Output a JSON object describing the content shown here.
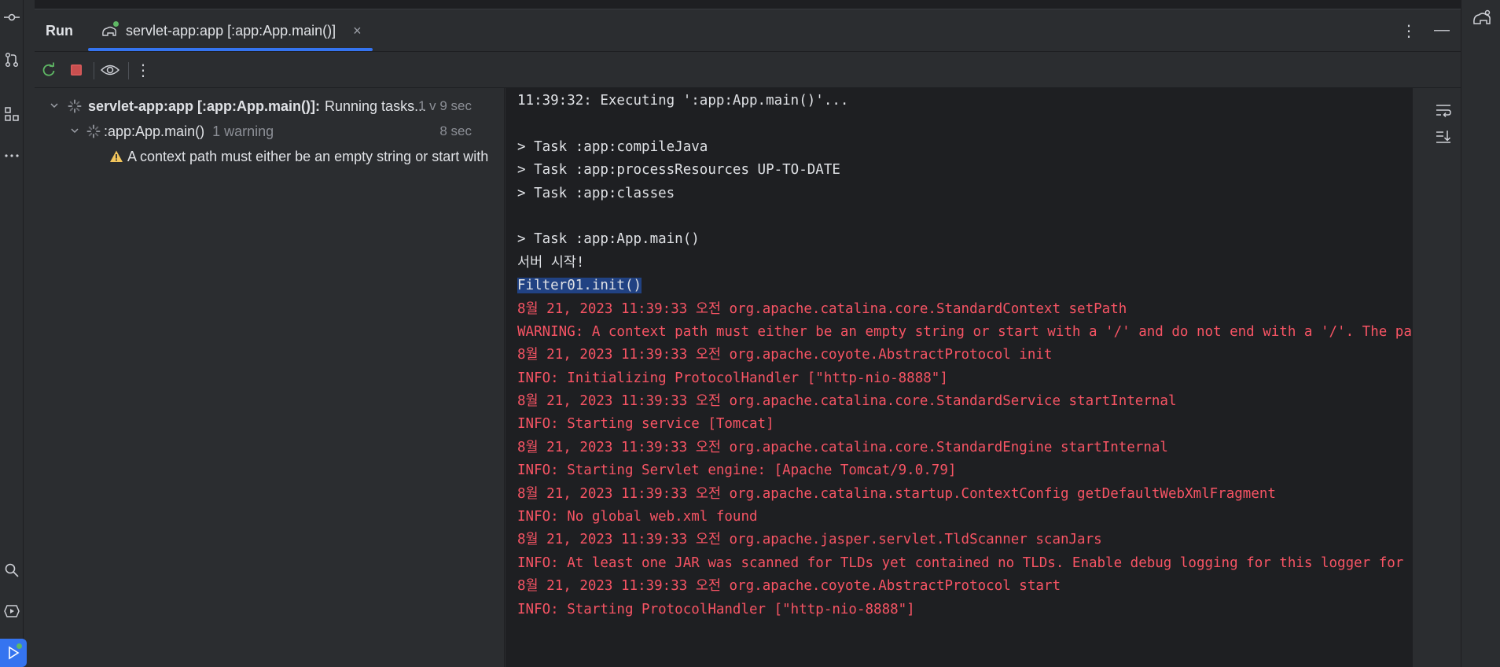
{
  "header": {
    "title": "Run",
    "tab_label": "servlet-app:app [:app:App.main()]",
    "close_glyph": "×",
    "more_glyph": "⋮",
    "minimize_glyph": "—"
  },
  "toolbar": {
    "items": [
      "rerun-icon",
      "stop-icon",
      "eye-icon",
      "more-vertical-icon"
    ],
    "more_glyph": "⋮"
  },
  "tree": {
    "root": {
      "name": "servlet-app:app [:app:App.main()]:",
      "status": "Running tasks...",
      "time": "1 v 9 sec"
    },
    "child": {
      "name": ":app:App.main()",
      "note": "1 warning",
      "time": "8 sec"
    },
    "warning": {
      "text": "A context path must either be an empty string or start with"
    }
  },
  "console": {
    "lines": [
      {
        "text": "11:39:32: Executing ':app:App.main()'...",
        "style": "normal"
      },
      {
        "text": "",
        "style": "normal"
      },
      {
        "text": "> Task :app:compileJava",
        "style": "normal"
      },
      {
        "text": "> Task :app:processResources UP-TO-DATE",
        "style": "normal"
      },
      {
        "text": "> Task :app:classes",
        "style": "normal"
      },
      {
        "text": "",
        "style": "normal"
      },
      {
        "text": "> Task :app:App.main()",
        "style": "normal"
      },
      {
        "text": "서버 시작!",
        "style": "normal"
      },
      {
        "text": "Filter01.init()",
        "style": "selected"
      },
      {
        "text": "8월 21, 2023 11:39:33 오전 org.apache.catalina.core.StandardContext setPath",
        "style": "err"
      },
      {
        "text": "WARNING: A context path must either be an empty string or start with a '/' and do not end with a '/'. The path [/]",
        "style": "err"
      },
      {
        "text": "8월 21, 2023 11:39:33 오전 org.apache.coyote.AbstractProtocol init",
        "style": "err"
      },
      {
        "text": "INFO: Initializing ProtocolHandler [\"http-nio-8888\"]",
        "style": "err"
      },
      {
        "text": "8월 21, 2023 11:39:33 오전 org.apache.catalina.core.StandardService startInternal",
        "style": "err"
      },
      {
        "text": "INFO: Starting service [Tomcat]",
        "style": "err"
      },
      {
        "text": "8월 21, 2023 11:39:33 오전 org.apache.catalina.core.StandardEngine startInternal",
        "style": "err"
      },
      {
        "text": "INFO: Starting Servlet engine: [Apache Tomcat/9.0.79]",
        "style": "err"
      },
      {
        "text": "8월 21, 2023 11:39:33 오전 org.apache.catalina.startup.ContextConfig getDefaultWebXmlFragment",
        "style": "err"
      },
      {
        "text": "INFO: No global web.xml found",
        "style": "err"
      },
      {
        "text": "8월 21, 2023 11:39:33 오전 org.apache.jasper.servlet.TldScanner scanJars",
        "style": "err"
      },
      {
        "text": "INFO: At least one JAR was scanned for TLDs yet contained no TLDs. Enable debug logging for this logger for a comp",
        "style": "err"
      },
      {
        "text": "8월 21, 2023 11:39:33 오전 org.apache.coyote.AbstractProtocol start",
        "style": "err"
      },
      {
        "text": "INFO: Starting ProtocolHandler [\"http-nio-8888\"]",
        "style": "err"
      }
    ]
  },
  "colors": {
    "accent": "#3574f0",
    "error_text": "#f75464",
    "console_bg": "#1e1f22",
    "panel_bg": "#2b2d30",
    "selection": "#214283",
    "warning": "#f2c55c",
    "running_dot": "#5fb865"
  }
}
